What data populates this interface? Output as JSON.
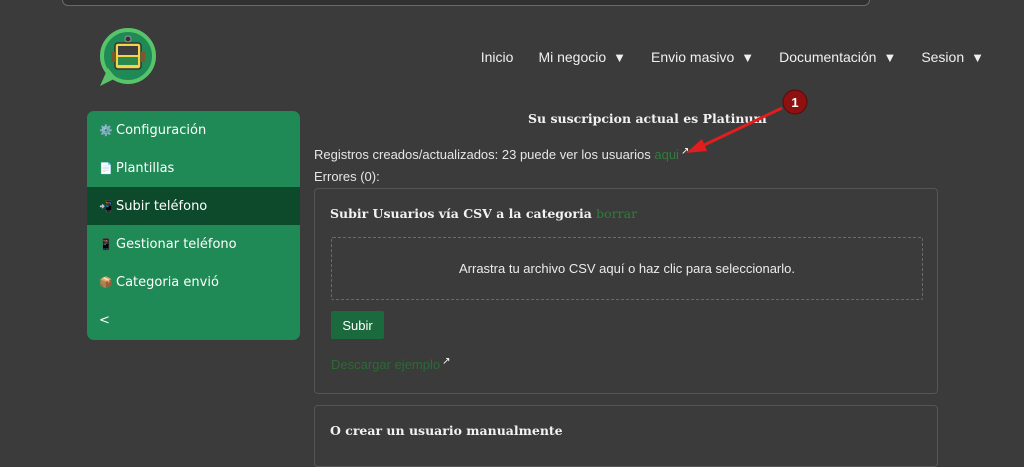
{
  "nav": {
    "items": [
      {
        "label": "Inicio",
        "has_caret": false
      },
      {
        "label": "Mi negocio",
        "has_caret": true
      },
      {
        "label": "Envio masivo",
        "has_caret": true
      },
      {
        "label": "Documentación",
        "has_caret": true
      },
      {
        "label": "Sesion",
        "has_caret": true
      }
    ],
    "caret": "▼"
  },
  "sidebar": {
    "items": [
      {
        "label": "Configuración",
        "icon": "gear-icon",
        "glyph": "⚙️",
        "active": false
      },
      {
        "label": "Plantillas",
        "icon": "document-icon",
        "glyph": "📄",
        "active": false
      },
      {
        "label": "Subir teléfono",
        "icon": "upload-icon",
        "glyph": "📲",
        "active": true
      },
      {
        "label": "Gestionar teléfono",
        "icon": "phone-list-icon",
        "glyph": "📱",
        "active": false
      },
      {
        "label": "Categoria envió",
        "icon": "package-icon",
        "glyph": "📦",
        "active": false
      }
    ],
    "collapse_label": "<"
  },
  "main": {
    "subscription_text": "Su suscripcion actual es Platinum",
    "registros_text": "Registros creados/actualizados: 23 puede ver los usuarios ",
    "registros_link": "aqui",
    "errores_text": "Errores (0):",
    "upload_card": {
      "title": "Subir Usuarios vía CSV a la categoria ",
      "title_link": "borrar",
      "dropzone_text": "Arrastra tu archivo CSV aquí o haz clic para seleccionarlo.",
      "submit_label": "Subir",
      "download_link": "Descargar ejemplo"
    },
    "manual_card": {
      "title": "O crear un usuario manualmente"
    }
  },
  "annotation": {
    "number": "1",
    "color": "#e01e1e"
  },
  "colors": {
    "background": "#3b3b3b",
    "sidebar": "#1f8a55",
    "sidebar_active": "#0d4a2c",
    "button": "#1b6a3e",
    "link": "#2f7d3c"
  }
}
